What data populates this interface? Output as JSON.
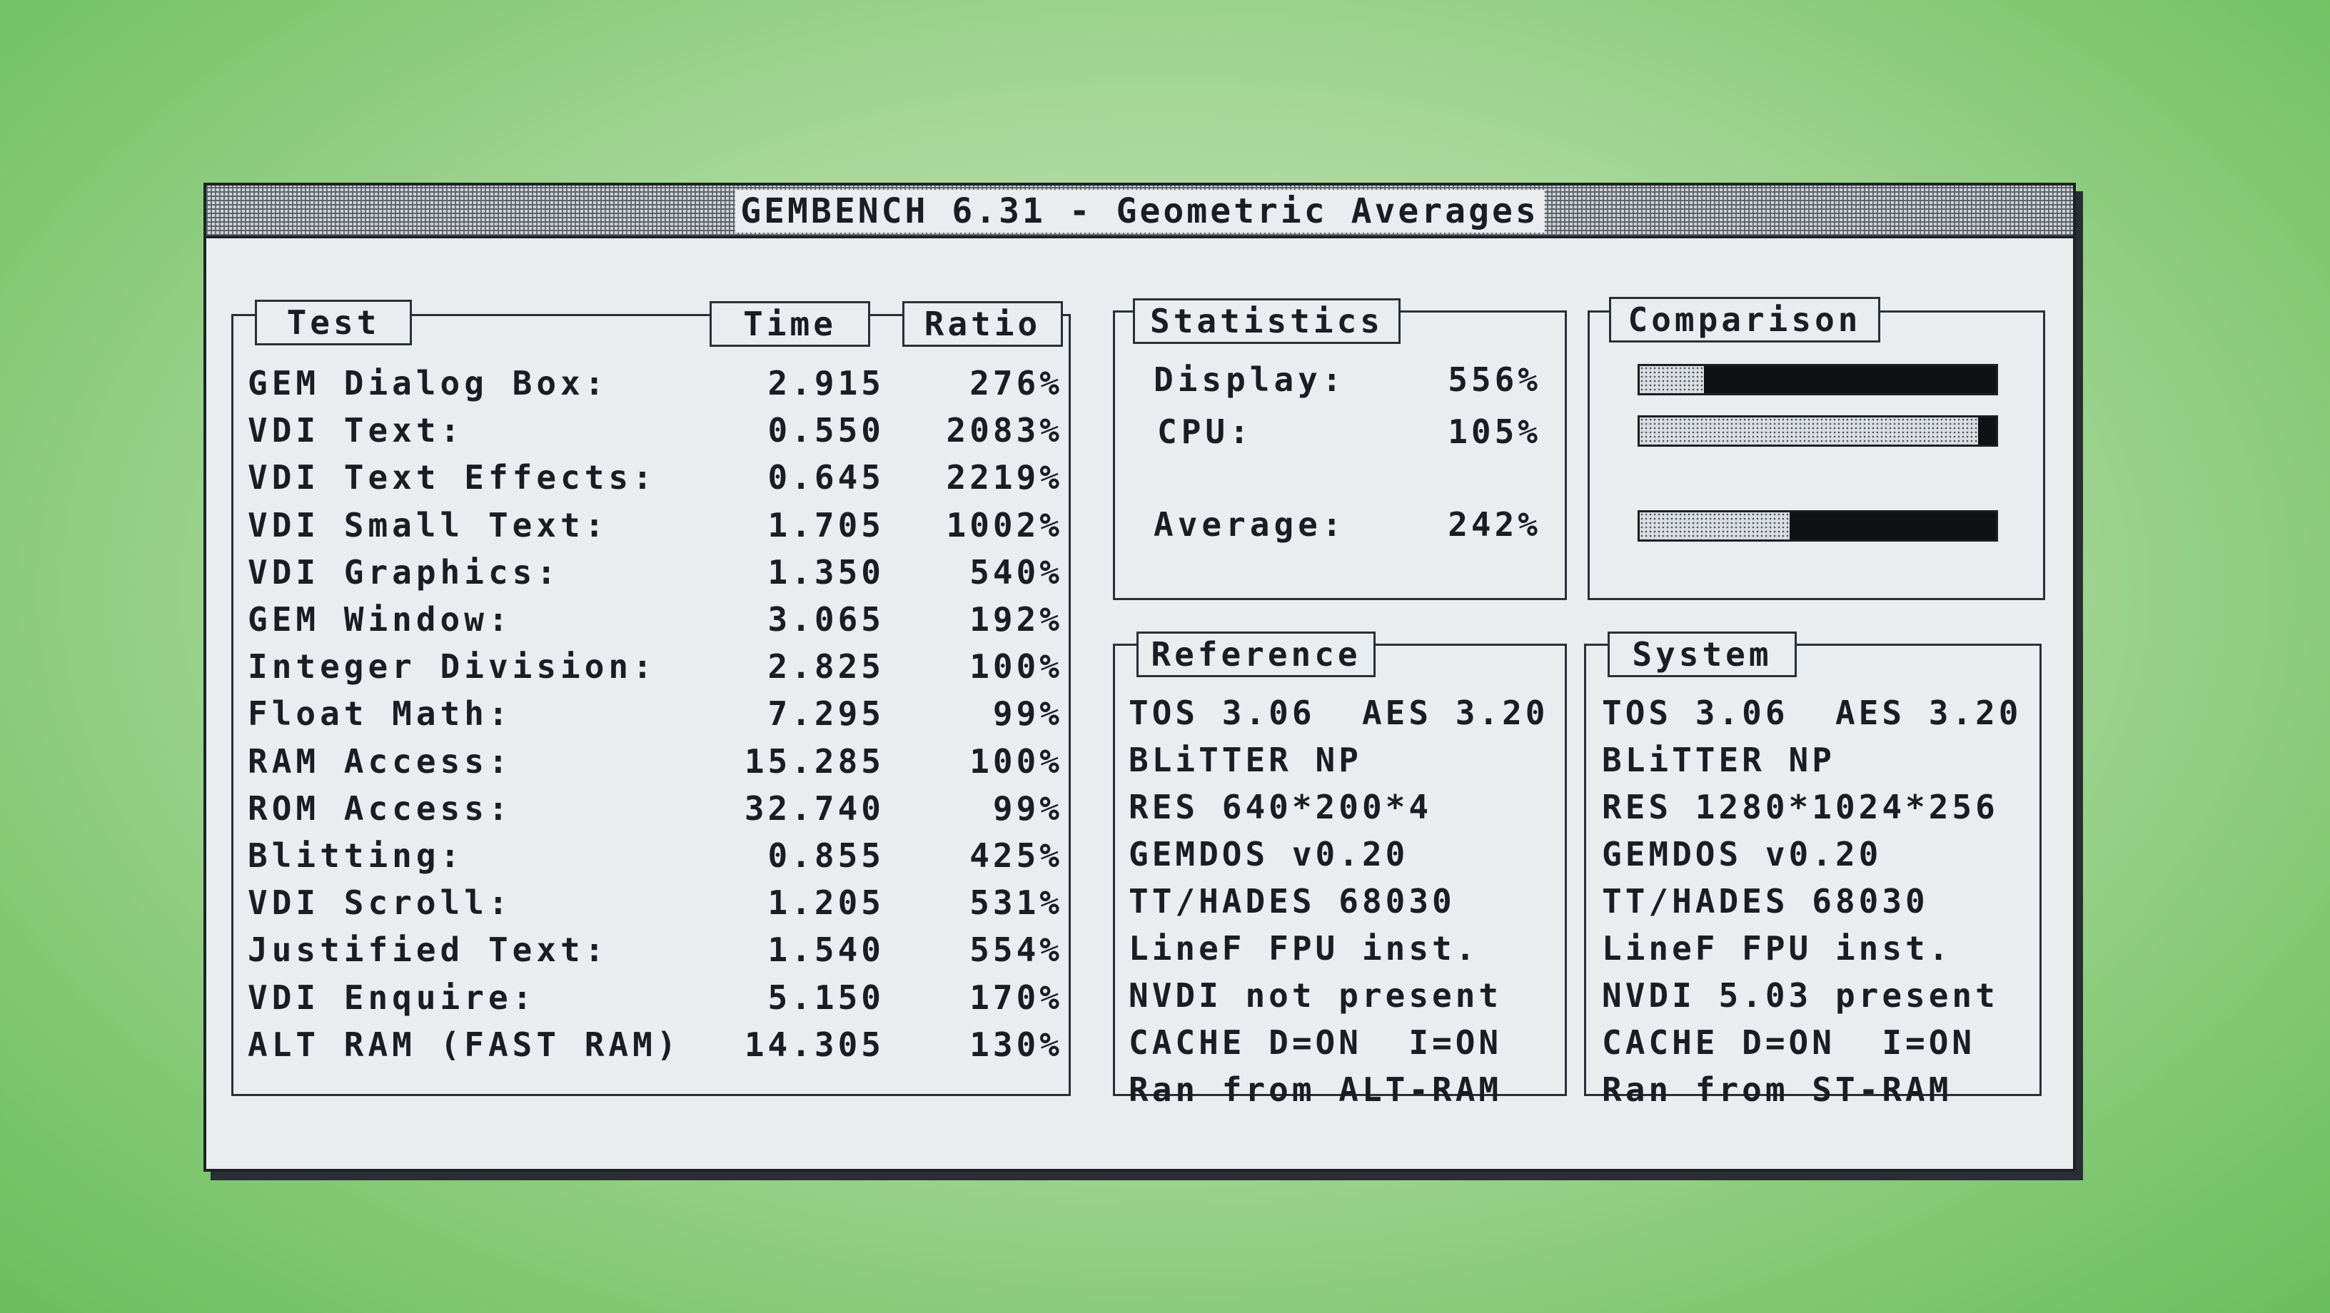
{
  "window": {
    "title": "GEMBENCH 6.31 - Geometric Averages"
  },
  "test_panel": {
    "headers": {
      "test": "Test",
      "time": "Time",
      "ratio": "Ratio"
    },
    "rows": [
      {
        "name": "GEM Dialog Box:",
        "time": "2.915",
        "ratio": "276%"
      },
      {
        "name": "VDI Text:",
        "time": "0.550",
        "ratio": "2083%"
      },
      {
        "name": "VDI Text Effects:",
        "time": "0.645",
        "ratio": "2219%"
      },
      {
        "name": "VDI Small Text:",
        "time": "1.705",
        "ratio": "1002%"
      },
      {
        "name": "VDI Graphics:",
        "time": "1.350",
        "ratio": "540%"
      },
      {
        "name": "GEM Window:",
        "time": "3.065",
        "ratio": "192%"
      },
      {
        "name": "Integer Division:",
        "time": "2.825",
        "ratio": "100%"
      },
      {
        "name": "Float Math:",
        "time": "7.295",
        "ratio": "99%"
      },
      {
        "name": "RAM Access:",
        "time": "15.285",
        "ratio": "100%"
      },
      {
        "name": "ROM Access:",
        "time": "32.740",
        "ratio": "99%"
      },
      {
        "name": "Blitting:",
        "time": "0.855",
        "ratio": "425%"
      },
      {
        "name": "VDI Scroll:",
        "time": "1.205",
        "ratio": "531%"
      },
      {
        "name": "Justified Text:",
        "time": "1.540",
        "ratio": "554%"
      },
      {
        "name": "VDI Enquire:",
        "time": "5.150",
        "ratio": "170%"
      },
      {
        "name": "ALT RAM (FAST RAM)",
        "time": "14.305",
        "ratio": "130%"
      }
    ]
  },
  "statistics": {
    "label": "Statistics",
    "display_label": "Display:",
    "display_value": "556%",
    "cpu_label": "CPU:",
    "cpu_value": "105%",
    "average_label": "Average:",
    "average_value": "242%"
  },
  "comparison": {
    "label": "Comparison",
    "display_fill": 0.18,
    "cpu_fill": 0.95,
    "average_fill": 0.42
  },
  "reference": {
    "label": "Reference",
    "lines": [
      "TOS 3.06  AES 3.20",
      "BLiTTER NP",
      "RES 640*200*4",
      "GEMDOS v0.20",
      "TT/HADES 68030",
      "LineF FPU inst.",
      "NVDI not present",
      "CACHE D=ON  I=ON",
      "Ran from ALT-RAM"
    ]
  },
  "system": {
    "label": "System",
    "lines": [
      "TOS 3.06  AES 3.20",
      "BLiTTER NP",
      "RES 1280*1024*256",
      "GEMDOS v0.20",
      "TT/HADES 68030",
      "LineF FPU inst.",
      "NVDI 5.03 present",
      "CACHE D=ON  I=ON",
      "Ran from ST-RAM"
    ]
  }
}
